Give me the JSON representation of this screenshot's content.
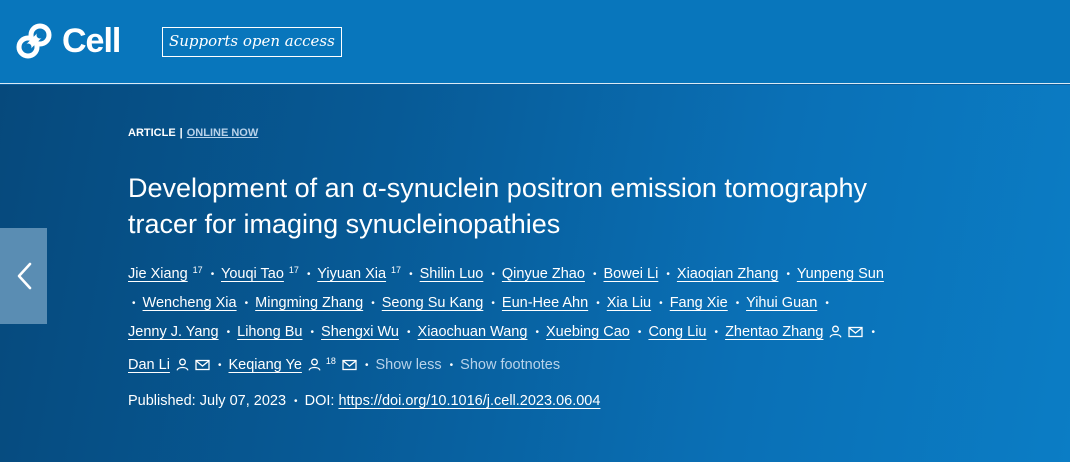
{
  "brand": {
    "name": "Cell",
    "badge": "Supports open access"
  },
  "article": {
    "type": "ARTICLE",
    "separator": "|",
    "status": "ONLINE NOW",
    "title": "Development of an α-synuclein positron emission tomography tracer for imaging synucleinopathies",
    "authors": [
      {
        "name": "Jie Xiang",
        "sup": "17"
      },
      {
        "name": "Youqi Tao",
        "sup": "17"
      },
      {
        "name": "Yiyuan Xia",
        "sup": "17"
      },
      {
        "name": "Shilin Luo"
      },
      {
        "name": "Qinyue Zhao"
      },
      {
        "name": "Bowei Li"
      },
      {
        "name": "Xiaoqian Zhang"
      },
      {
        "name": "Yunpeng Sun"
      },
      {
        "name": "Wencheng Xia"
      },
      {
        "name": "Mingming Zhang"
      },
      {
        "name": "Seong Su Kang"
      },
      {
        "name": "Eun-Hee Ahn"
      },
      {
        "name": "Xia Liu"
      },
      {
        "name": "Fang Xie"
      },
      {
        "name": "Yihui Guan"
      },
      {
        "name": "Jenny J. Yang"
      },
      {
        "name": "Lihong Bu"
      },
      {
        "name": "Shengxi Wu"
      },
      {
        "name": "Xiaochuan Wang"
      },
      {
        "name": "Xuebing Cao"
      },
      {
        "name": "Cong Liu"
      },
      {
        "name": "Zhentao Zhang",
        "icons": [
          "person-icon",
          "mail-icon"
        ]
      },
      {
        "name": "Dan Li",
        "icons": [
          "person-icon",
          "mail-icon"
        ]
      },
      {
        "name": "Keqiang Ye",
        "icons": [
          "person-icon"
        ],
        "sup": "18",
        "icons_after": [
          "mail-icon"
        ]
      }
    ],
    "show_less": "Show less",
    "show_footnotes": "Show footnotes",
    "published_label": "Published:",
    "published_date": "July 07, 2023",
    "doi_label": "DOI:",
    "doi_url": "https://doi.org/10.1016/j.cell.2023.06.004"
  },
  "colors": {
    "header": "#0876bc",
    "hero_start": "#06497c",
    "hero_end": "#0b7dc5",
    "arrow_bg": "#5a8db3",
    "muted_link": "#b8d2ea"
  },
  "icons": {
    "prev": "chevron-left-icon",
    "logo": "cell-logo-icon"
  }
}
